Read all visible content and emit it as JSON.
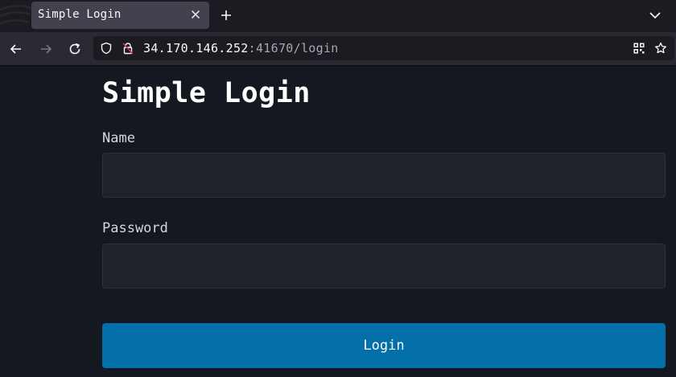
{
  "browser": {
    "tab_title": "Simple Login",
    "url_host": "34.170.146.252",
    "url_rest": ":41670/login"
  },
  "icons": {
    "back": "back-arrow-icon",
    "forward": "forward-arrow-icon",
    "reload": "reload-icon",
    "shield": "shield-icon",
    "insecure": "insecure-lock-icon",
    "qr": "qr-code-icon",
    "bookmark": "star-icon",
    "close_tab": "close-icon",
    "new_tab": "plus-icon",
    "tab_list": "chevron-down-icon"
  },
  "page": {
    "heading": "Simple Login",
    "name_label": "Name",
    "name_value": "",
    "password_label": "Password",
    "password_value": "",
    "login_label": "Login"
  },
  "colors": {
    "page_background": "#141820",
    "input_background": "#1e222b",
    "button_background": "#0370a9",
    "insecure_icon": "#e22850"
  }
}
